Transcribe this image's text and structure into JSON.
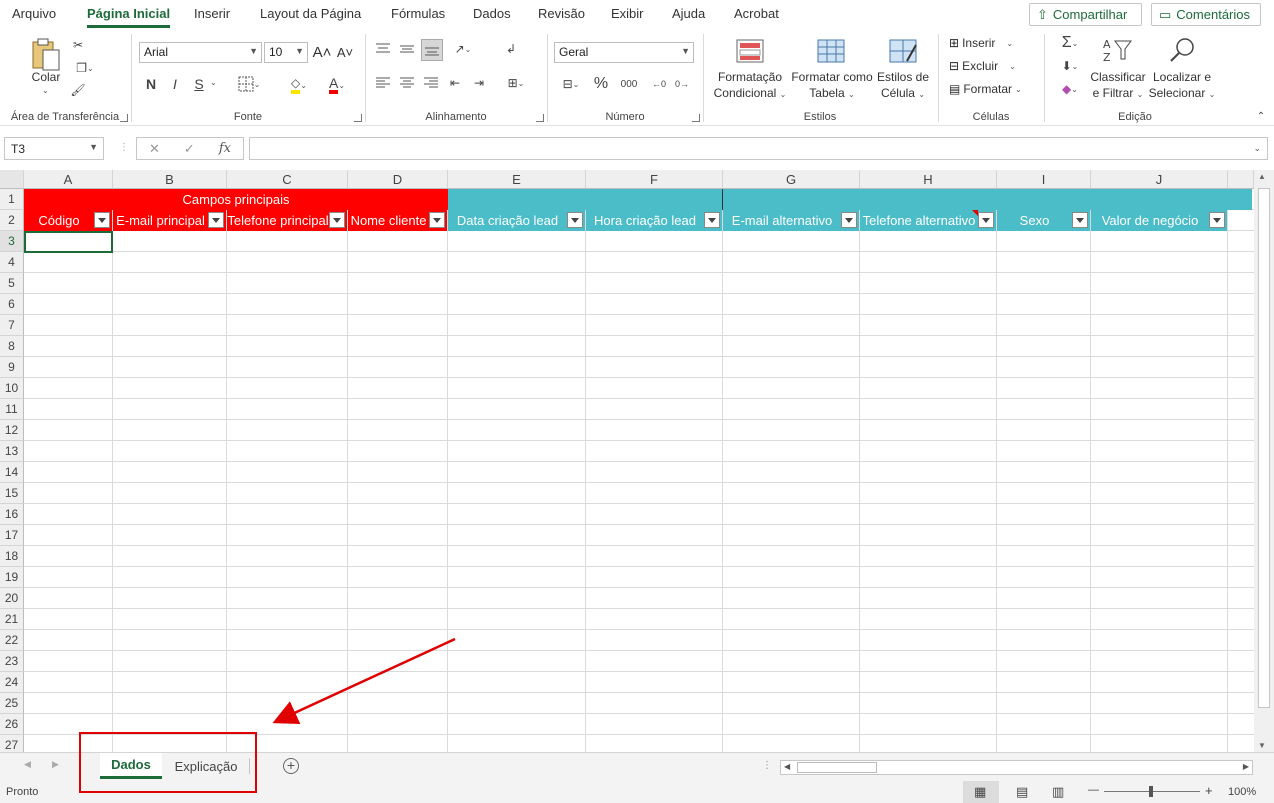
{
  "ribbon": {
    "tabs": [
      "Arquivo",
      "Página Inicial",
      "Inserir",
      "Layout da Página",
      "Fórmulas",
      "Dados",
      "Revisão",
      "Exibir",
      "Ajuda",
      "Acrobat"
    ],
    "share_label": "Compartilhar",
    "comments_label": "Comentários",
    "clipboard": {
      "paste_label": "Colar",
      "group_label": "Área de Transferência"
    },
    "font": {
      "name": "Arial",
      "size": "10",
      "bold": "N",
      "italic": "I",
      "underline": "S",
      "font_color": "A",
      "group_label": "Fonte"
    },
    "alignment": {
      "group_label": "Alinhamento"
    },
    "number": {
      "format": "Geral",
      "percent": "%",
      "thousands": "000",
      "group_label": "Número"
    },
    "styles": {
      "conditional_line1": "Formatação",
      "conditional_line2": "Condicional",
      "table_line1": "Formatar como",
      "table_line2": "Tabela",
      "cell_line1": "Estilos de",
      "cell_line2": "Célula",
      "group_label": "Estilos"
    },
    "cells": {
      "insert": "Inserir",
      "delete": "Excluir",
      "format": "Formatar",
      "group_label": "Células"
    },
    "editing": {
      "sort_line1": "Classificar",
      "sort_line2": "e Filtrar",
      "find_line1": "Localizar e",
      "find_line2": "Selecionar",
      "group_label": "Edição"
    }
  },
  "formula_bar": {
    "name_box": "T3",
    "fx": "fx",
    "value": ""
  },
  "grid": {
    "columns": [
      "A",
      "B",
      "C",
      "D",
      "E",
      "F",
      "G",
      "H",
      "I",
      "J"
    ],
    "rows": [
      "1",
      "2",
      "3",
      "4",
      "5",
      "6",
      "7",
      "8",
      "9",
      "10",
      "11",
      "12",
      "13",
      "14",
      "15",
      "16",
      "17",
      "18",
      "19",
      "20",
      "21",
      "22",
      "23",
      "24",
      "25",
      "26",
      "27"
    ],
    "selected_row": "3",
    "band_label": "Campos principais",
    "headers": [
      "Código",
      "E-mail principal",
      "Telefone principal",
      "Nome cliente",
      "Data criação lead",
      "Hora criação lead",
      "E-mail alternativo",
      "Telefone alternativo",
      "Sexo",
      "Valor de negócio"
    ],
    "colors": {
      "primary_band": "#ff0000",
      "secondary_band": "#4bbdc9"
    }
  },
  "sheets": {
    "tabs": [
      "Dados",
      "Explicação"
    ],
    "active": "Dados"
  },
  "status": {
    "text": "Pronto",
    "zoom": "100%"
  },
  "annotation": {
    "color": "#e00000"
  }
}
